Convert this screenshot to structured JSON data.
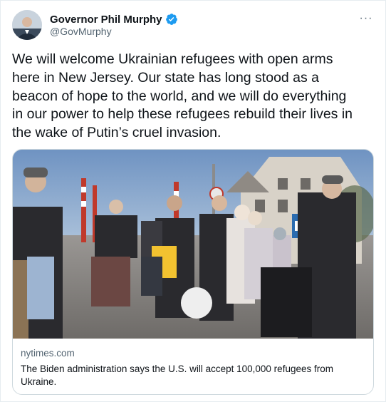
{
  "author": {
    "display_name": "Governor Phil Murphy",
    "handle": "@GovMurphy",
    "verified": true
  },
  "tweet": {
    "text": "We will welcome Ukrainian refugees with open arms\nhere in New Jersey. Our state has long stood as a\nbeacon of hope to the world, and we will do everything\nin our power to help these refugees rebuild their lives in\nthe wake of Putin’s cruel invasion."
  },
  "card": {
    "domain": "nytimes.com",
    "title": "The Biden administration says the U.S. will accept 100,000 refugees from Ukraine."
  },
  "menu": {
    "more_label": "···"
  },
  "colors": {
    "verified": "#1d9bf0",
    "secondary_text": "#536471",
    "border": "#cfd9de"
  }
}
